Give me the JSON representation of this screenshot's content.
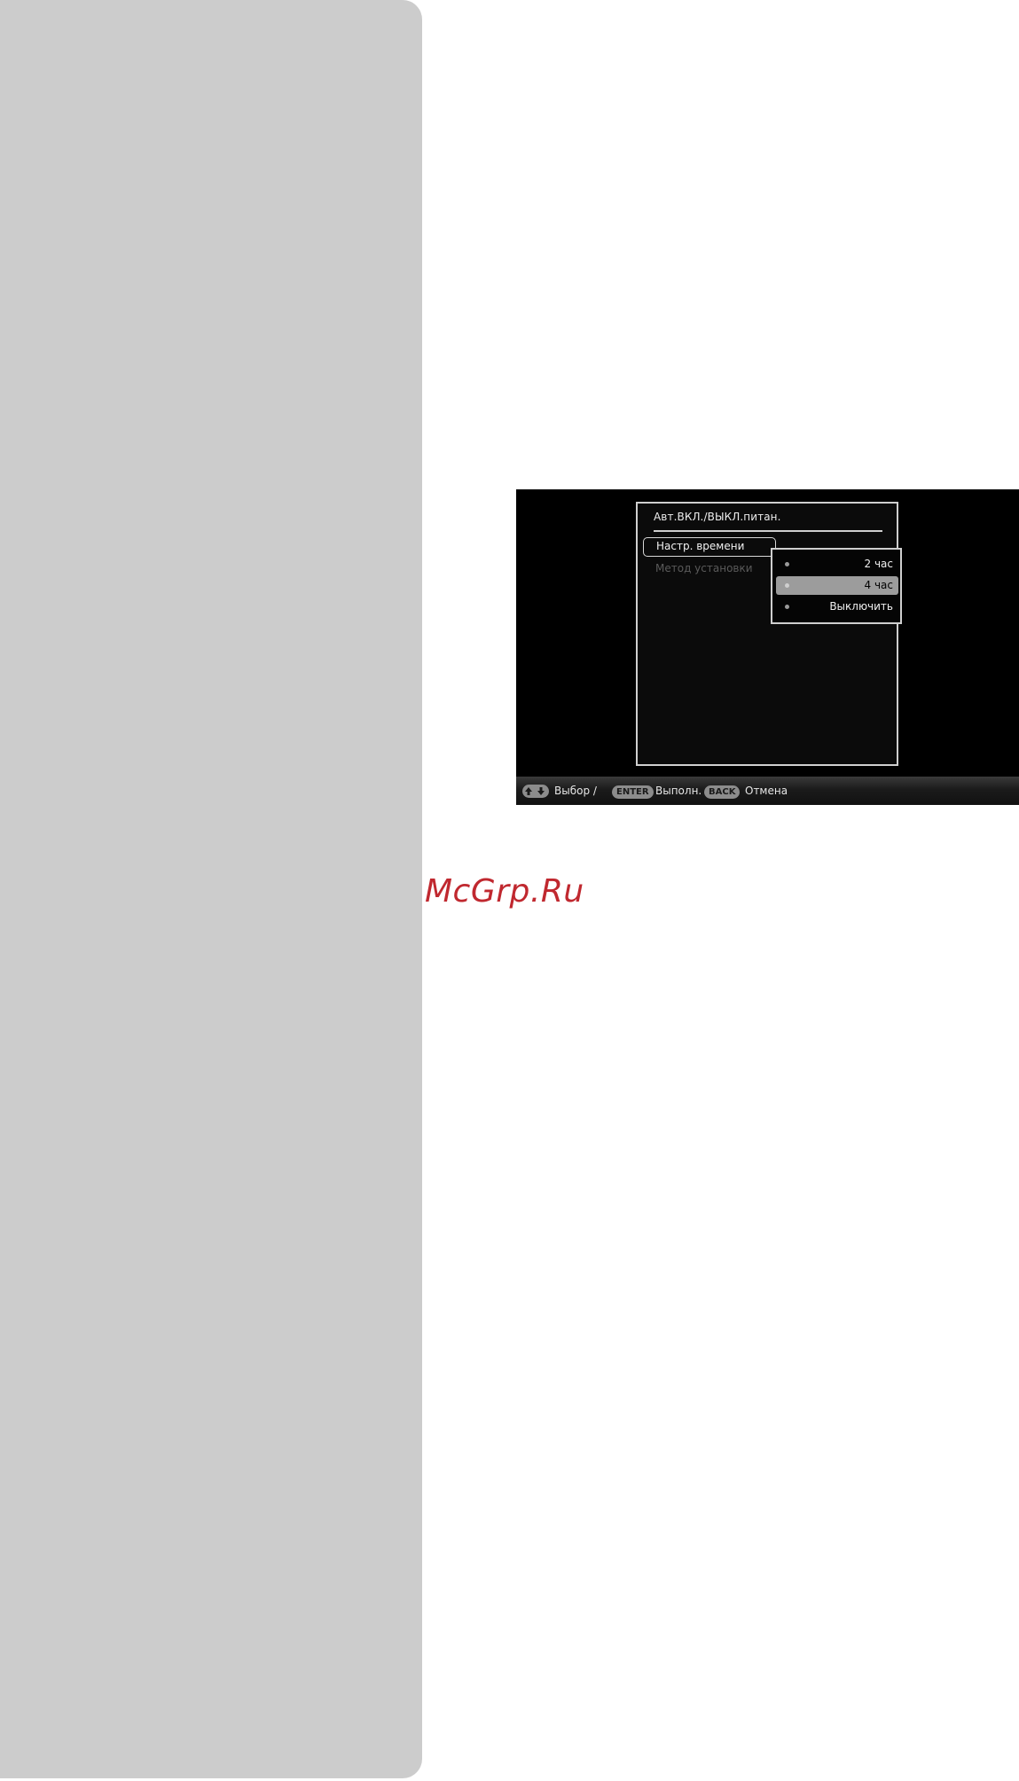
{
  "menu": {
    "title": "Авт.ВКЛ./ВЫКЛ.питан.",
    "items": [
      {
        "label": "Настр. времени",
        "state": "active"
      },
      {
        "label": "Метод установки",
        "state": "disabled"
      }
    ]
  },
  "submenu": {
    "options": [
      {
        "label": "2 час",
        "selected": false
      },
      {
        "label": "4 час",
        "selected": true
      },
      {
        "label": "Выключить",
        "selected": false
      }
    ]
  },
  "bottom_bar": {
    "arrows_icon": "up-down-arrows-icon",
    "select_label": "Выбор /",
    "enter_key": "ENTER",
    "enter_label": "Выполн.",
    "back_key": "BACK",
    "back_label": "Отмена"
  },
  "watermark": {
    "text": "McGrp.Ru"
  },
  "colors": {
    "side_panel": "#cccccc",
    "screen_bg": "#000000",
    "selected_option": "#9c9c9c",
    "watermark": "#c0282f"
  }
}
